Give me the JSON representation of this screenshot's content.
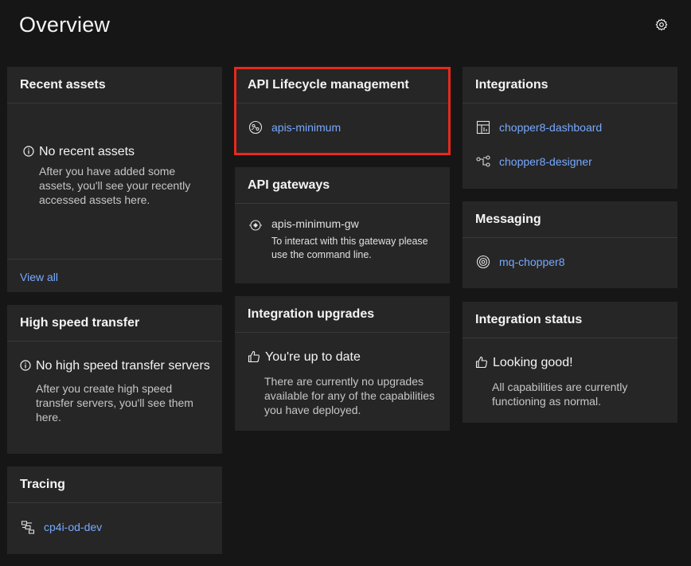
{
  "page": {
    "title": "Overview"
  },
  "settings": {
    "icon": "gear-icon"
  },
  "colors": {
    "background": "#161616",
    "tile": "#262626",
    "link": "#78a9ff",
    "highlight": "#e8291c"
  },
  "recent_assets": {
    "title": "Recent assets",
    "empty_title": "No recent assets",
    "empty_body": "After you have added some assets, you'll see your recently accessed assets here.",
    "view_all": "View all"
  },
  "high_speed_transfer": {
    "title": "High speed transfer",
    "empty_title": "No high speed transfer servers",
    "empty_body": "After you create high speed transfer servers, you'll see them here."
  },
  "tracing": {
    "title": "Tracing",
    "items": [
      {
        "label": "cp4i-od-dev",
        "icon": "tracing-icon"
      }
    ]
  },
  "api_lifecycle": {
    "title": "API Lifecycle management",
    "items": [
      {
        "label": "apis-minimum",
        "icon": "api-icon"
      }
    ]
  },
  "api_gateways": {
    "title": "API gateways",
    "items": [
      {
        "label": "apis-minimum-gw",
        "note": "To interact with this gateway please use the command line.",
        "icon": "gateway-icon"
      }
    ]
  },
  "integration_upgrades": {
    "title": "Integration upgrades",
    "status_title": "You're up to date",
    "status_body": "There are currently no upgrades available for any of the capabilities you have deployed."
  },
  "integrations": {
    "title": "Integrations",
    "items": [
      {
        "label": "chopper8-dashboard",
        "icon": "dashboard-icon"
      },
      {
        "label": "chopper8-designer",
        "icon": "designer-icon"
      }
    ]
  },
  "messaging": {
    "title": "Messaging",
    "items": [
      {
        "label": "mq-chopper8",
        "icon": "queue-manager-icon"
      }
    ]
  },
  "integration_status": {
    "title": "Integration status",
    "status_title": "Looking good!",
    "status_body": "All capabilities are currently functioning as normal."
  }
}
